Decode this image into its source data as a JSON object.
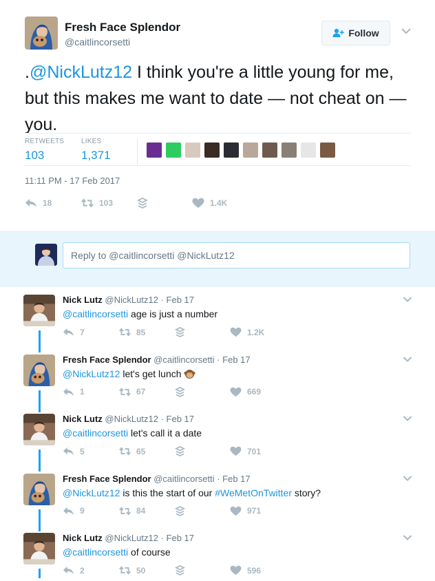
{
  "tweet": {
    "author_name": "Fresh Face Splendor",
    "author_handle": "@caitlincorsetti",
    "follow_label": "Follow",
    "text_prefix": ".",
    "text_mention": "@NickLutz12",
    "text_body": " I think you're a little young for me, but this makes me want to date — not cheat on — you.",
    "retweets_label": "RETWEETS",
    "retweets_value": "103",
    "likes_label": "LIKES",
    "likes_value": "1,371",
    "timestamp": "11:11 PM - 17 Feb 2017",
    "actions": {
      "reply": "18",
      "retweet": "103",
      "like": "1.4K"
    }
  },
  "liker_colors": [
    "#6a2c91",
    "#2ecc5f",
    "#d8c9bf",
    "#3a2b25",
    "#2b2b33",
    "#b9a89a",
    "#6f5a4d",
    "#8a7f74",
    "#e6e6e6",
    "#7b5a44"
  ],
  "reply_box": {
    "placeholder": "Reply to @caitlincorsetti @NickLutz12"
  },
  "replies": [
    {
      "name": "Nick Lutz",
      "handle": "@NickLutz12",
      "date": "Feb 17",
      "mention": "@caitlincorsetti",
      "text": " age is just a number",
      "reply_count": "7",
      "retweet_count": "85",
      "like_count": "1.2K"
    },
    {
      "name": "Fresh Face Splendor",
      "handle": "@caitlincorsetti",
      "date": "Feb 17",
      "mention": "@NickLutz12",
      "text": " let's get lunch",
      "emoji": "monkey-emoji",
      "reply_count": "1",
      "retweet_count": "67",
      "like_count": "669"
    },
    {
      "name": "Nick Lutz",
      "handle": "@NickLutz12",
      "date": "Feb 17",
      "mention": "@caitlincorsetti",
      "text": " let's call it a date",
      "reply_count": "5",
      "retweet_count": "65",
      "like_count": "701"
    },
    {
      "name": "Fresh Face Splendor",
      "handle": "@caitlincorsetti",
      "date": "Feb 17",
      "mention": "@NickLutz12",
      "text": " is this the start of our ",
      "hashtag": "#WeMetOnTwitter",
      "text_after": " story?",
      "reply_count": "9",
      "retweet_count": "84",
      "like_count": "971"
    },
    {
      "name": "Nick Lutz",
      "handle": "@NickLutz12",
      "date": "Feb 17",
      "mention": "@caitlincorsetti",
      "text": " of course",
      "reply_count": "2",
      "retweet_count": "50",
      "like_count": "596"
    }
  ],
  "colors": {
    "accent": "#1b95e0",
    "thread_line": "#1da1f2",
    "muted": "#657786",
    "action_gray": "#aab8c2",
    "reply_box_bg": "#e8f5fd"
  }
}
